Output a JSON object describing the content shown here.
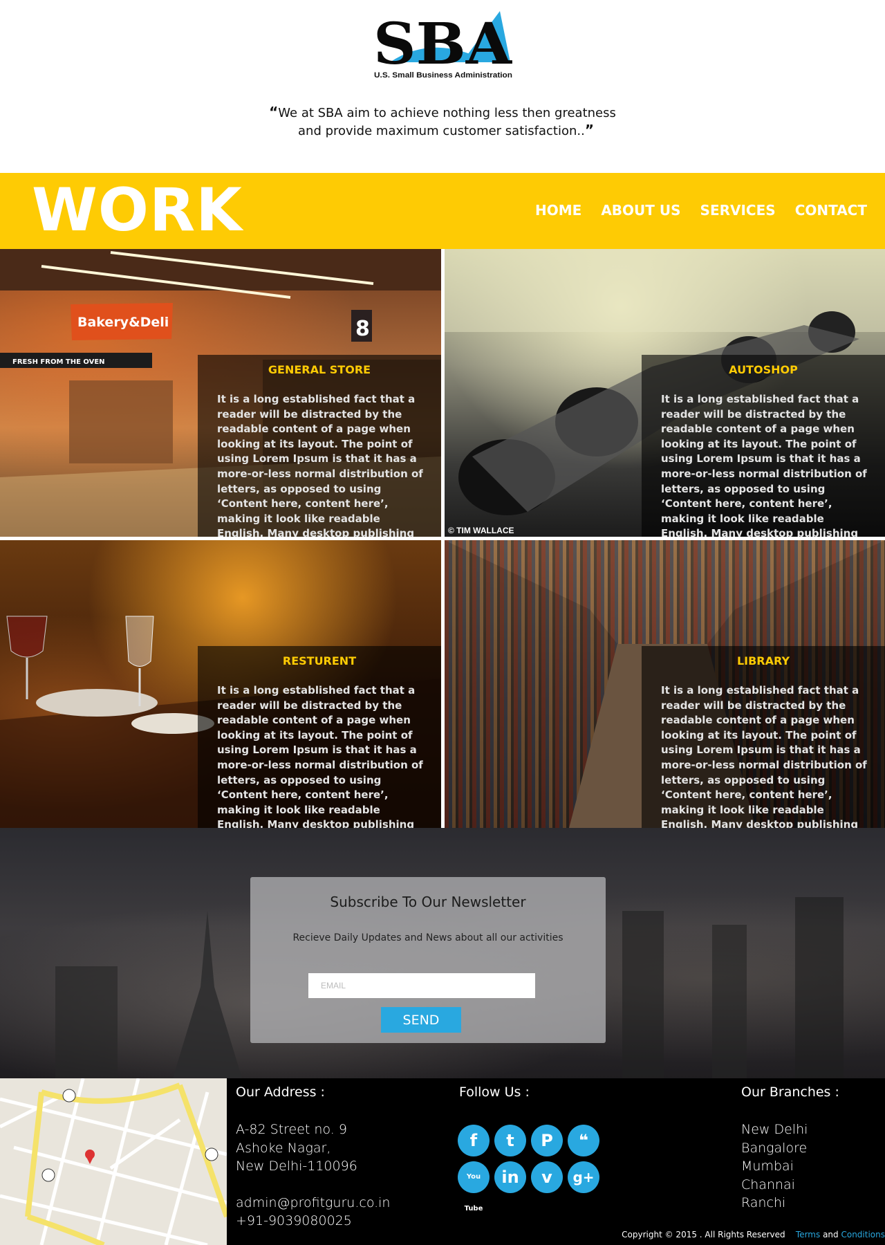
{
  "header": {
    "logo_text": "SBA",
    "logo_subtitle": "U.S. Small Business Administration",
    "quote_line1": "We at SBA aim to achieve nothing less then greatness",
    "quote_line2": "and provide maximum customer satisfaction..",
    "quote_open": "“",
    "quote_close": "”"
  },
  "banner": {
    "title": "WORK",
    "nav": [
      "HOME",
      "ABOUT US",
      "SERVICES",
      "CONTACT"
    ],
    "color": "#fecb04"
  },
  "tiles": [
    {
      "title": "GENERAL STORE",
      "text": "It is a long established fact that a reader will be distracted by the readable content of a page when looking at its layout. The point of using Lorem Ipsum is that it has a more-or-less normal distribution of letters, as opposed to using ‘Content here, content here’, making it look like readable English. Many desktop publishing",
      "image_labels": [
        "Bakery&Deli",
        "FRESH FROM THE OVEN",
        "8"
      ]
    },
    {
      "title": "AUTOSHOP",
      "text": "It is a long established fact that a reader will be distracted by the readable content of a page when looking at its layout. The point of using Lorem Ipsum is that it has a more-or-less normal distribution of letters, as opposed to using ‘Content here, content here’, making it look like readable English. Many desktop publishing",
      "credit": "© TIM WALLACE"
    },
    {
      "title": "RESTURENT",
      "text": "It is a long established fact that a reader will be distracted by the readable content of a page when looking at its layout. The point of using Lorem Ipsum is that it has a more-or-less normal distribution of letters, as opposed to using ‘Content here, content here’, making it look like readable English. Many desktop publishing"
    },
    {
      "title": "LIBRARY",
      "text": "It is a long established fact that a reader will be distracted by the readable content of a page when looking at its layout. The point of using Lorem Ipsum is that it has a more-or-less normal distribution of letters, as opposed to using ‘Content here, content here’, making it look like readable English. Many desktop publishing"
    }
  ],
  "newsletter": {
    "title": "Subscribe To Our Newsletter",
    "subtitle": "Recieve Daily Updates and News about all our activities",
    "email_placeholder": "EMAIL",
    "send_label": "SEND",
    "button_color": "#29a8e0"
  },
  "footer": {
    "address_title": "Our Address :",
    "address_lines": [
      "A-82 Street no. 9",
      "Ashoke Nagar,",
      "New Delhi-110096"
    ],
    "email": "admin@profitguru.co.in",
    "phone": "+91-9039080025",
    "follow_title": "Follow Us :",
    "social": [
      "facebook-icon",
      "tumblr-icon",
      "pinterest-icon",
      "twitter-icon",
      "youtube-icon",
      "linkedin-icon",
      "vimeo-icon",
      "google-plus-icon"
    ],
    "social_glyphs": [
      "f",
      "t",
      "P",
      "❝",
      "You Tube",
      "in",
      "v",
      "g+"
    ],
    "branches_title": "Our Branches :",
    "branches": [
      "New Delhi",
      "Bangalore",
      "Mumbai",
      "Channai",
      "Ranchi"
    ],
    "copyright": "Copyright © 2015 . All Rights Reserved",
    "terms": "Terms",
    "and": "and",
    "conditions": "Conditions"
  }
}
